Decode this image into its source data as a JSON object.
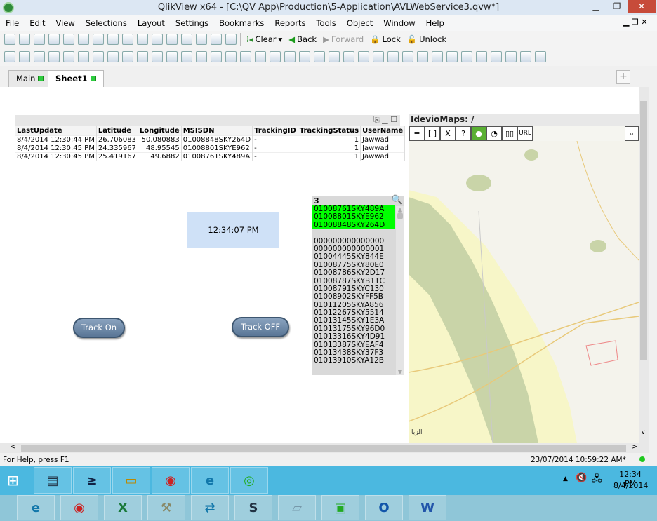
{
  "window": {
    "title": "QlikView x64 - [C:\\QV App\\Production\\5-Application\\AVLWebService3.qvw*]",
    "minimize": "▁",
    "restore": "❐",
    "close": "✕"
  },
  "menu": [
    "File",
    "Edit",
    "View",
    "Selections",
    "Layout",
    "Settings",
    "Bookmarks",
    "Reports",
    "Tools",
    "Object",
    "Window",
    "Help"
  ],
  "toolbar1": {
    "icons_a": [
      "new-icon",
      "open-icon",
      "reload-icon",
      "save-icon",
      "print-icon",
      "edit-script-icon",
      "reload-data-icon",
      "undo-icon",
      "redo-icon",
      "search-icon",
      "select-icon",
      "chart-icon",
      "favorite-icon",
      "properties-icon",
      "help-icon",
      "whats-this-icon"
    ],
    "clear": "Clear",
    "back": "Back",
    "forward": "Forward",
    "lock": "Lock",
    "unlock": "Unlock"
  },
  "toolbar2": {
    "icons": [
      "new-sheet-icon",
      "import-icon",
      "export-icon",
      "sheet-props-icon",
      "listbox-icon",
      "statistics-icon",
      "table-box-icon",
      "multibox-icon",
      "chart-icon",
      "input-box-icon",
      "current-selections-icon",
      "button-icon",
      "text-icon",
      "line-arrow-icon",
      "slider-icon",
      "bookmark-icon",
      "search-object-icon",
      "container-icon",
      "custom-object-icon",
      "design-grid-icon",
      "eraser-icon",
      "align-icon",
      "align-left-icon",
      "align-center-icon",
      "align-right-icon",
      "align-bottom-icon",
      "align-middle-icon",
      "align-top-icon",
      "space-vertical-icon",
      "space-horizontal-icon",
      "adjust-left-icon",
      "adjust-top-icon",
      "user-icon",
      "document-props-icon",
      "edit-module-icon",
      "network-icon",
      "webview-icon"
    ]
  },
  "tabs": [
    {
      "label": "Main"
    },
    {
      "label": "Sheet1"
    }
  ],
  "add_sheet": "+",
  "table": {
    "columns": [
      "LastUpdate",
      "Latitude",
      "Longitude",
      "MSISDN",
      "TrackingID",
      "TrackingStatus",
      "UserName"
    ],
    "rows": [
      [
        "8/4/2014 12:30:44 PM",
        "26.706083",
        "50.080883",
        "01008848SKY264D",
        "-",
        "1",
        "Jawwad"
      ],
      [
        "8/4/2014 12:30:45 PM",
        "24.335967",
        "48.95545",
        "01008801SKYE962",
        "-",
        "1",
        "Jawwad"
      ],
      [
        "8/4/2014 12:30:45 PM",
        "25.419167",
        "49.6882",
        "01008761SKY489A",
        "-",
        "1",
        "Jawwad"
      ]
    ]
  },
  "clock": "12:34:07 PM",
  "buttons": {
    "track_on": "Track On",
    "track_off": "Track OFF"
  },
  "listbox": {
    "title": "3",
    "selected": [
      "01008761SKY489A",
      "01008801SKYE962",
      "01008848SKY264D"
    ],
    "items": [
      "000000000000000",
      "000000000000001",
      "01004445SKY844E",
      "01008775SKY80E0",
      "01008786SKY2D17",
      "01008787SKYB11C",
      "01008791SKYC130",
      "01008902SKYFF5B",
      "01011205SKYA856",
      "01012267SKY5514",
      "01013145SKY1E3A",
      "01013175SKY96D0",
      "01013316SKY4D91",
      "01013387SKYEAF4",
      "01013438SKY37F3",
      "01013910SKYA12B"
    ]
  },
  "map": {
    "title": "IdevioMaps: /",
    "buttons": [
      "≡",
      "[ ]",
      "X",
      "?",
      "●",
      "◔",
      "▯▯",
      "URL"
    ],
    "place_label": "الزبا"
  },
  "status": {
    "help": "For Help, press F1",
    "timestamp": "23/07/2014 10:59:22 AM*"
  },
  "taskbar": {
    "time": "12:34 PM",
    "date": "8/4/2014"
  }
}
